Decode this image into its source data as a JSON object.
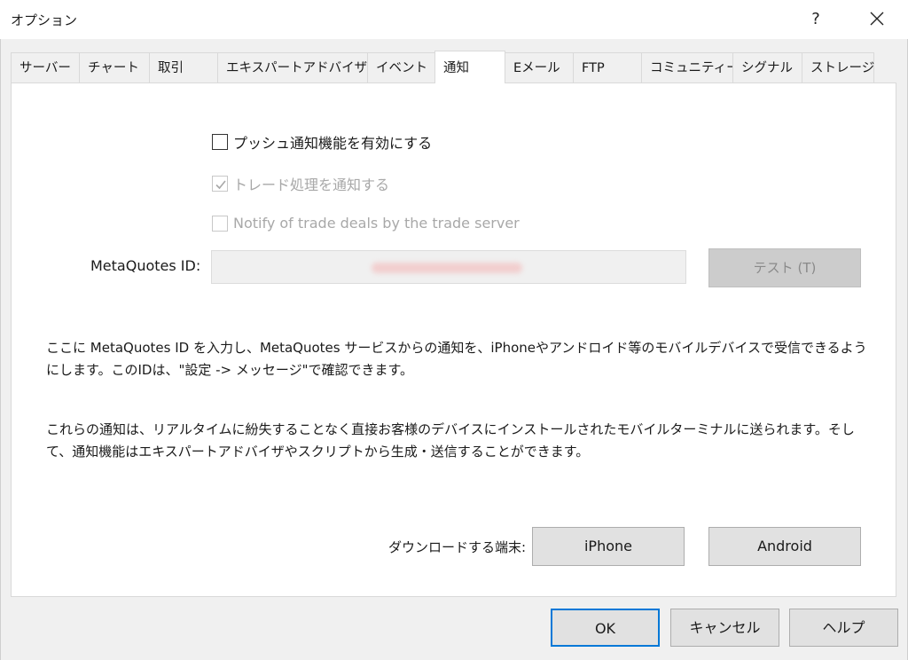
{
  "window": {
    "title": "オプション",
    "help_label": "?"
  },
  "tabs": [
    {
      "label": "サーバー"
    },
    {
      "label": "チャート"
    },
    {
      "label": "取引"
    },
    {
      "label": "エキスパートアドバイザ"
    },
    {
      "label": "イベント"
    },
    {
      "label": "通知"
    },
    {
      "label": "Eメール"
    },
    {
      "label": "FTP"
    },
    {
      "label": "コミュニティー"
    },
    {
      "label": "シグナル"
    },
    {
      "label": "ストレージ"
    }
  ],
  "active_tab": "通知",
  "notifications": {
    "enable_push": {
      "label": "プッシュ通知機能を有効にする",
      "checked": false,
      "enabled": true
    },
    "notify_trades": {
      "label": "トレード処理を通知する",
      "checked": true,
      "enabled": false
    },
    "notify_deals": {
      "label": "Notify of trade deals by the trade server",
      "checked": false,
      "enabled": false
    },
    "metaquotes_id_label": "MetaQuotes ID:",
    "test_button": "テスト (T)",
    "description_1": "ここに MetaQuotes ID を入力し、MetaQuotes サービスからの通知を、iPhoneやアンドロイド等のモバイルデバイスで受信できるようにします。このIDは、\"設定 -> メッセージ\"で確認できます。",
    "description_2": "これらの通知は、リアルタイムに紛失することなく直接お客様のデバイスにインストールされたモバイルターミナルに送られます。そして、通知機能はエキスパートアドバイザやスクリプトから生成・送信することができます。",
    "download_label": "ダウンロードする端末:",
    "iphone_button": "iPhone",
    "android_button": "Android"
  },
  "footer": {
    "ok": "OK",
    "cancel": "キャンセル",
    "help": "ヘルプ"
  },
  "colors": {
    "accent": "#0078d7",
    "disabled_text": "#a8a8a8",
    "dialog_bg": "#f0f0f0"
  }
}
